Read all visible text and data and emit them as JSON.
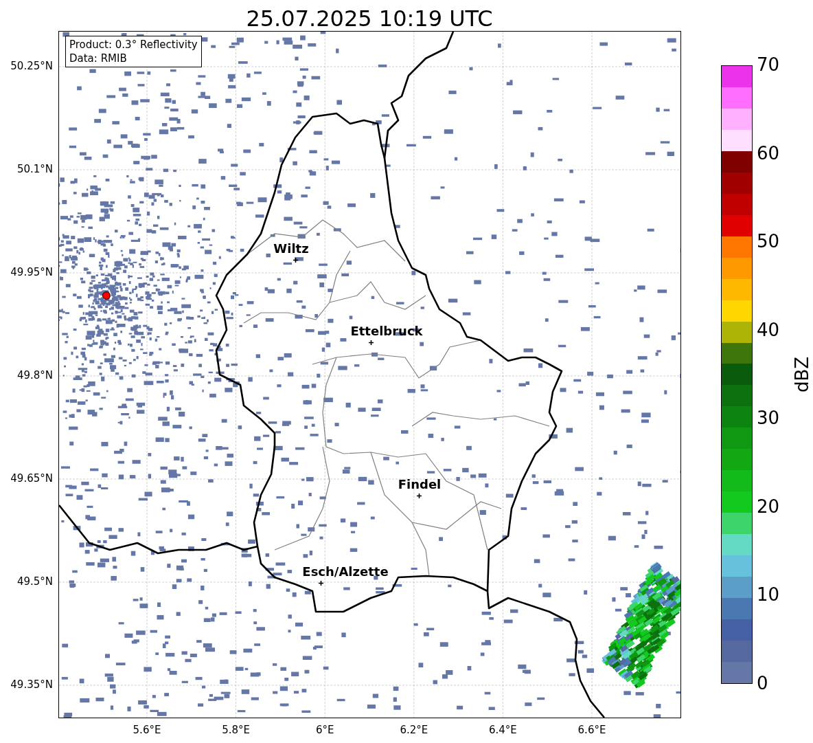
{
  "title": "25.07.2025 10:19 UTC",
  "info_box": [
    "Product: 0.3° Reflectivity",
    "Data: RMIB"
  ],
  "y_ticks": [
    "50.25°N",
    "50.1°N",
    "49.95°N",
    "49.8°N",
    "49.65°N",
    "49.5°N",
    "49.35°N"
  ],
  "x_ticks": [
    "5.6°E",
    "5.8°E",
    "6°E",
    "6.2°E",
    "6.4°E",
    "6.6°E"
  ],
  "cities": [
    {
      "name": "Wiltz"
    },
    {
      "name": "Ettelbruck"
    },
    {
      "name": "Findel"
    },
    {
      "name": "Esch/Alzette"
    }
  ],
  "colorbar": {
    "label": "dBZ",
    "ticks": [
      "70",
      "60",
      "50",
      "40",
      "30",
      "20",
      "10",
      "0"
    ],
    "bins": [
      {
        "color": "#6477a6"
      },
      {
        "color": "#5568a0"
      },
      {
        "color": "#4560a5"
      },
      {
        "color": "#4a78b0"
      },
      {
        "color": "#5b9ec8"
      },
      {
        "color": "#66c1dc"
      },
      {
        "color": "#64d9c4"
      },
      {
        "color": "#3dd46c"
      },
      {
        "color": "#12c91e"
      },
      {
        "color": "#13bb1a"
      },
      {
        "color": "#12a814"
      },
      {
        "color": "#0f9812"
      },
      {
        "color": "#0e8410"
      },
      {
        "color": "#0b720e"
      },
      {
        "color": "#0a5c0c"
      },
      {
        "color": "#3f760c"
      },
      {
        "color": "#adb405"
      },
      {
        "color": "#ffd700"
      },
      {
        "color": "#ffb800"
      },
      {
        "color": "#ff9900"
      },
      {
        "color": "#ff7700"
      },
      {
        "color": "#e00000"
      },
      {
        "color": "#c00000"
      },
      {
        "color": "#a00000"
      },
      {
        "color": "#800000"
      },
      {
        "color": "#ffdfff"
      },
      {
        "color": "#ffb0ff"
      },
      {
        "color": "#ff6eff"
      },
      {
        "color": "#ea33ea"
      }
    ]
  }
}
